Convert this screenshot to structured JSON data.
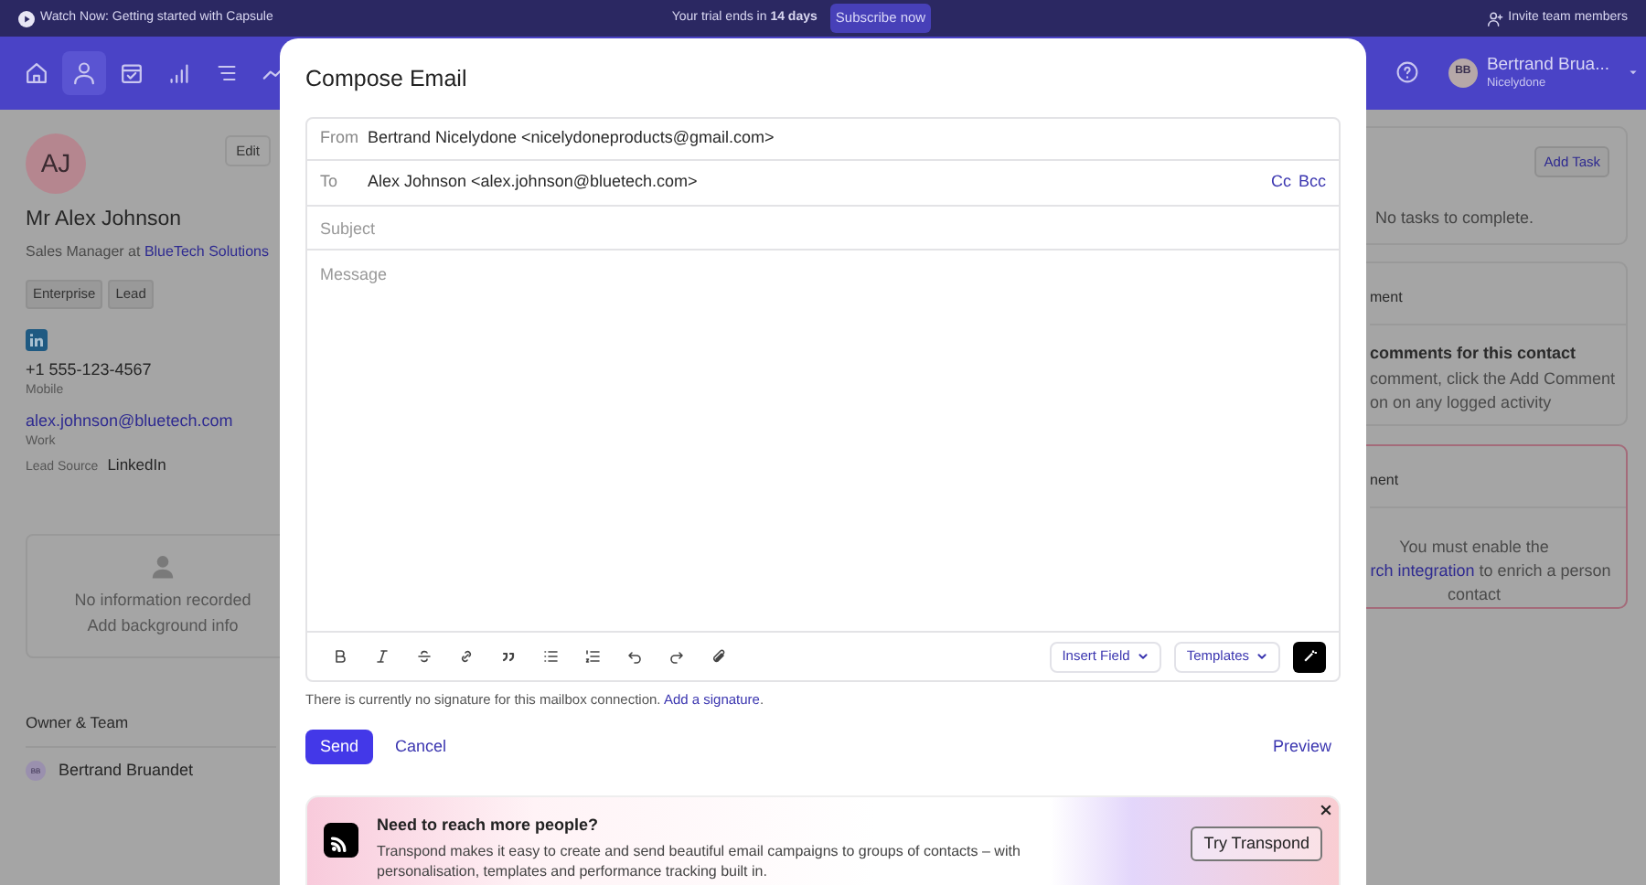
{
  "top_bar": {
    "promo": "Watch Now: Getting started with Capsule",
    "trial": "Your trial ends in **14 days**",
    "subscribe": "Subscribe now",
    "invite": "Invite team members"
  },
  "nav": {
    "items": [
      {
        "kind": "home",
        "selected": false
      },
      {
        "kind": "person",
        "selected": true
      },
      {
        "kind": "calendar",
        "selected": false
      },
      {
        "kind": "chart",
        "selected": false
      },
      {
        "kind": "list",
        "selected": false
      },
      {
        "kind": "trend",
        "selected": false
      }
    ],
    "user": {
      "initials": "BB",
      "name": "Bertrand Brua...",
      "org": "Nicelydone"
    }
  },
  "contact": {
    "initials": "AJ",
    "edit": "Edit",
    "name": "Mr Alex Johnson",
    "role": "Sales Manager at",
    "company": "BlueTech Solutions",
    "tags": [
      "Enterprise",
      "Lead"
    ],
    "phone": "+1 555-123-4567",
    "phone_label": "Mobile",
    "email": "alex.johnson@bluetech.com",
    "email_label": "Work",
    "lead_source_label": "Lead Source",
    "lead_source": "LinkedIn",
    "background": {
      "line1": "No information recorded",
      "line2": "Add background info"
    },
    "owner_heading": "Owner & Team",
    "owner": {
      "initials": "BB",
      "name": "Bertrand Bruandet"
    }
  },
  "tasks": {
    "button": "Add Task",
    "empty": "No tasks to complete."
  },
  "comments": {
    "heading": "ment",
    "title": "comments for this contact",
    "lines": [
      "comment, click the Add Comment",
      "on on any logged activity"
    ]
  },
  "enrichment": {
    "heading": "nent",
    "line1": "You must enable the",
    "link": "rch integration",
    "line2": " to enrich a person",
    "line3": "contact"
  },
  "modal": {
    "title": "Compose Email",
    "from_label": "From",
    "from": "Bertrand Nicelydone <nicelydoneproducts@gmail.com>",
    "to_label": "To",
    "to": "Alex Johnson <alex.johnson@bluetech.com>",
    "cc": "Cc",
    "bcc": "Bcc",
    "subject_placeholder": "Subject",
    "message_placeholder": "Message",
    "toolbar": [
      {
        "kind": "bold"
      },
      {
        "kind": "italic"
      },
      {
        "kind": "strike"
      },
      {
        "kind": "link"
      },
      {
        "kind": "quote"
      },
      {
        "kind": "bullets"
      },
      {
        "kind": "numbers"
      },
      {
        "kind": "undo"
      },
      {
        "kind": "redo"
      },
      {
        "kind": "attach"
      }
    ],
    "insert_field": "Insert Field",
    "templates": "Templates",
    "signature_text": "There is currently no signature for this mailbox connection. ",
    "signature_link": "Add a signature",
    "signature_end": ".",
    "send": "Send",
    "cancel": "Cancel",
    "preview": "Preview",
    "banner": {
      "title": "Need to reach more people?",
      "body": "Transpond makes it easy to create and send beautiful email campaigns to groups of contacts – with personalisation, templates and performance tracking built in.",
      "button": "Try Transpond"
    }
  }
}
